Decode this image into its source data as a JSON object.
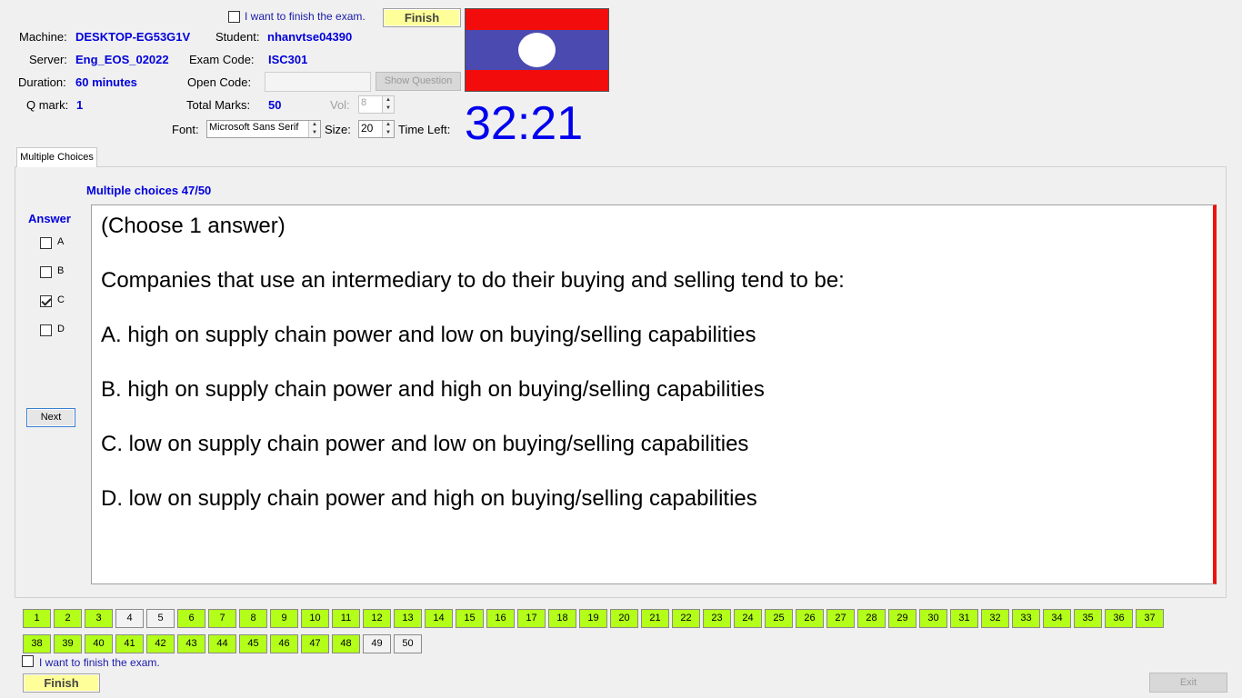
{
  "header": {
    "finish_check_label": "I want to finish the exam.",
    "finish_button": "Finish",
    "machine_label": "Machine:",
    "machine_value": "DESKTOP-EG53G1V",
    "student_label": "Student:",
    "student_value": "nhanvtse04390",
    "server_label": "Server:",
    "server_value": "Eng_EOS_02022",
    "exam_code_label": "Exam Code:",
    "exam_code_value": "ISC301",
    "duration_label": "Duration:",
    "duration_value": "60 minutes",
    "open_code_label": "Open Code:",
    "open_code_value": "",
    "show_question_button": "Show Question",
    "qmark_label": "Q mark:",
    "qmark_value": "1",
    "total_marks_label": "Total Marks:",
    "total_marks_value": "50",
    "vol_label": "Vol:",
    "vol_value": "8",
    "font_label": "Font:",
    "font_value": "Microsoft Sans Serif",
    "size_label": "Size:",
    "size_value": "20",
    "time_left_label": "Time Left:",
    "time_left_value": "32:21"
  },
  "tab": {
    "label": "Multiple Choices"
  },
  "panel": {
    "progress_title": "Multiple choices 47/50",
    "answer_label": "Answer",
    "options": [
      {
        "label": "A",
        "checked": false
      },
      {
        "label": "B",
        "checked": false
      },
      {
        "label": "C",
        "checked": true
      },
      {
        "label": "D",
        "checked": false
      }
    ],
    "next_button": "Next"
  },
  "question": {
    "instruction": "(Choose 1 answer)",
    "stem": "Companies that use an intermediary to do their buying and selling tend to be:",
    "choices": [
      "A.  high on supply chain power and low on buying/selling capabilities",
      "B.  high on supply chain power and high on buying/selling capabilities",
      "C.  low on supply chain power and low on buying/selling capabilities",
      "D.  low on supply chain power and high on buying/selling capabilities"
    ]
  },
  "navigator": {
    "row1": [
      {
        "n": "1",
        "answered": true
      },
      {
        "n": "2",
        "answered": true
      },
      {
        "n": "3",
        "answered": true
      },
      {
        "n": "4",
        "answered": false
      },
      {
        "n": "5",
        "answered": false
      },
      {
        "n": "6",
        "answered": true
      },
      {
        "n": "7",
        "answered": true
      },
      {
        "n": "8",
        "answered": true
      },
      {
        "n": "9",
        "answered": true
      },
      {
        "n": "10",
        "answered": true
      },
      {
        "n": "11",
        "answered": true
      },
      {
        "n": "12",
        "answered": true
      },
      {
        "n": "13",
        "answered": true
      },
      {
        "n": "14",
        "answered": true
      },
      {
        "n": "15",
        "answered": true
      },
      {
        "n": "16",
        "answered": true
      },
      {
        "n": "17",
        "answered": true
      },
      {
        "n": "18",
        "answered": true
      },
      {
        "n": "19",
        "answered": true
      },
      {
        "n": "20",
        "answered": true
      },
      {
        "n": "21",
        "answered": true
      },
      {
        "n": "22",
        "answered": true
      },
      {
        "n": "23",
        "answered": true
      },
      {
        "n": "24",
        "answered": true
      },
      {
        "n": "25",
        "answered": true
      },
      {
        "n": "26",
        "answered": true
      },
      {
        "n": "27",
        "answered": true
      },
      {
        "n": "28",
        "answered": true
      },
      {
        "n": "29",
        "answered": true
      },
      {
        "n": "30",
        "answered": true
      },
      {
        "n": "31",
        "answered": true
      },
      {
        "n": "32",
        "answered": true
      },
      {
        "n": "33",
        "answered": true
      },
      {
        "n": "34",
        "answered": true
      },
      {
        "n": "35",
        "answered": true
      },
      {
        "n": "36",
        "answered": true
      },
      {
        "n": "37",
        "answered": true
      }
    ],
    "row2": [
      {
        "n": "38",
        "answered": true
      },
      {
        "n": "39",
        "answered": true
      },
      {
        "n": "40",
        "answered": true
      },
      {
        "n": "41",
        "answered": true
      },
      {
        "n": "42",
        "answered": true
      },
      {
        "n": "43",
        "answered": true
      },
      {
        "n": "44",
        "answered": true
      },
      {
        "n": "45",
        "answered": true
      },
      {
        "n": "46",
        "answered": true
      },
      {
        "n": "47",
        "answered": true
      },
      {
        "n": "48",
        "answered": true
      },
      {
        "n": "49",
        "answered": false
      },
      {
        "n": "50",
        "answered": false
      }
    ]
  },
  "footer": {
    "finish_check_label": "I want to finish the exam.",
    "finish_button": "Finish",
    "exit_button": "Exit"
  },
  "colors": {
    "flag_red": "#f20c0c",
    "flag_blue": "#4a4ab0",
    "answered_green": "#b3ff1a",
    "timer_blue": "#0000ee",
    "accent_blue": "#0000dd"
  }
}
